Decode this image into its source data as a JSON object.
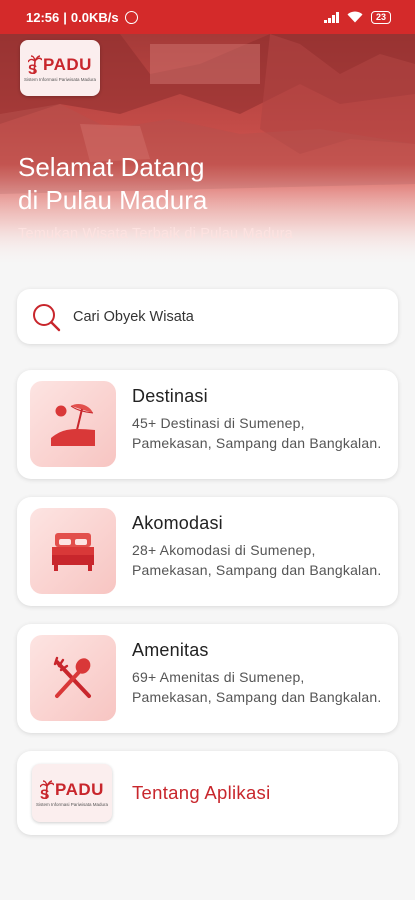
{
  "status_bar": {
    "time": "12:56",
    "network_speed": "0.0KB/s",
    "battery": "23",
    "icons": [
      "whatsapp-icon",
      "signal-icon",
      "wifi-icon",
      "battery-icon"
    ]
  },
  "hero": {
    "logo_text_s": "S",
    "logo_text_rest": "PADU",
    "logo_tagline": "Sistem Informasi Pariwisata Madura",
    "title_line1": "Selamat Datang",
    "title_line2": "di Pulau Madura",
    "subtitle": "Temukan Wisata Terbaik di Pulau Madura"
  },
  "search": {
    "placeholder": "Cari Obyek Wisata",
    "icon": "search-icon"
  },
  "menu": [
    {
      "title": "Destinasi",
      "description": "45+ Destinasi di Sumenep, Pamekasan, Sampang dan Bangkalan.",
      "icon": "beach-icon"
    },
    {
      "title": "Akomodasi",
      "description": "28+ Akomodasi di Sumenep, Pamekasan, Sampang dan Bangkalan.",
      "icon": "bed-icon"
    },
    {
      "title": "Amenitas",
      "description": "69+ Amenitas di Sumenep, Pamekasan, Sampang dan Bangkalan.",
      "icon": "fork-spoon-icon"
    }
  ],
  "about": {
    "label": "Tentang Aplikasi",
    "logo_text_s": "S",
    "logo_text_rest": "PADU",
    "logo_tagline": "Sistem Informasi Pariwisata Madura"
  },
  "colors": {
    "brand_red": "#d42a2a",
    "accent_red": "#c8262c",
    "icon_bg": "#fde4e2"
  }
}
